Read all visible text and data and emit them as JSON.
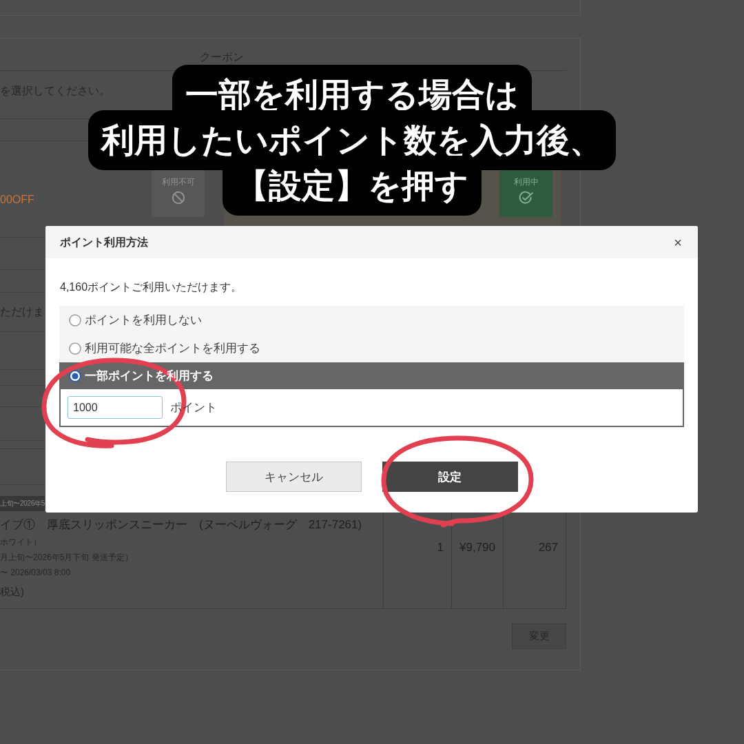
{
  "page": {
    "heading": "クーポン",
    "instruction": "を選択してください。",
    "discount": "00OFF",
    "coupon_buttons": [
      {
        "label": "利用不可",
        "kind": "unavailable"
      },
      {
        "label": "利用中",
        "kind": "in_use"
      }
    ],
    "points_note": "ただけま",
    "product": {
      "shipping_tag": "上旬〜2026年5",
      "name": "イブ①　厚底スリッポンスニーカー　(ヌーベルヴォーグ　217-7261)",
      "details": [
        "ホワイト）",
        "月上旬〜2026年5月下旬 発送予定）",
        "〜 2026/03/03 8:00"
      ],
      "price_note": "税込)",
      "quantity": "1",
      "price": "¥9,790",
      "points": "267"
    },
    "change_button": "変更"
  },
  "dialog": {
    "title": "ポイント利用方法",
    "close": "×",
    "message": "4,160ポイントご利用いただけます。",
    "options": [
      {
        "label": "ポイントを利用しない",
        "selected": false
      },
      {
        "label": "利用可能な全ポイントを利用する",
        "selected": false
      },
      {
        "label": "一部ポイントを利用する",
        "selected": true
      }
    ],
    "amount": {
      "value": "1000",
      "unit": "ポイント"
    },
    "buttons": [
      {
        "label": "キャンセル",
        "kind": "cancel"
      },
      {
        "label": "設定",
        "kind": "primary"
      }
    ]
  },
  "caption": {
    "lines": [
      "一部を利用する場合は",
      "利用したいポイント数を入力後、",
      "【設定】を押す"
    ]
  }
}
